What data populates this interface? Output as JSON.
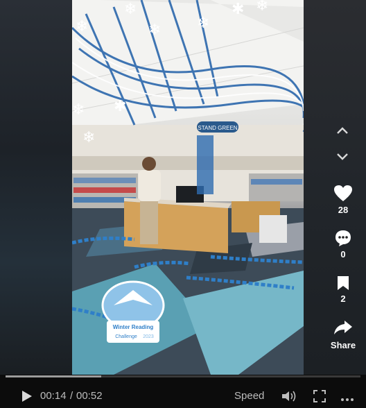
{
  "player": {
    "current_time": "00:14",
    "separator": "/",
    "duration": "00:52",
    "speed_label": "Speed",
    "progress_fraction": 0.27
  },
  "actions": {
    "likes": "28",
    "comments": "0",
    "saves": "2",
    "share_label": "Share"
  },
  "overlay": {
    "badge_line1": "Winter Reading",
    "badge_line2": "Challenge",
    "badge_year": "2023",
    "desk_sign": "STAND GREEN"
  },
  "icons": {
    "prev": "chevron-up-icon",
    "next": "chevron-down-icon",
    "like": "heart-icon",
    "comment": "comment-icon",
    "save": "bookmark-icon",
    "share": "share-arrow-icon",
    "play": "play-icon",
    "volume": "volume-icon",
    "fullscreen": "fullscreen-icon",
    "more": "more-icon"
  },
  "colors": {
    "accent_blue": "#2f7fc8",
    "chain_blue": "#1f5fa8",
    "carpet": "#3d4b58"
  }
}
